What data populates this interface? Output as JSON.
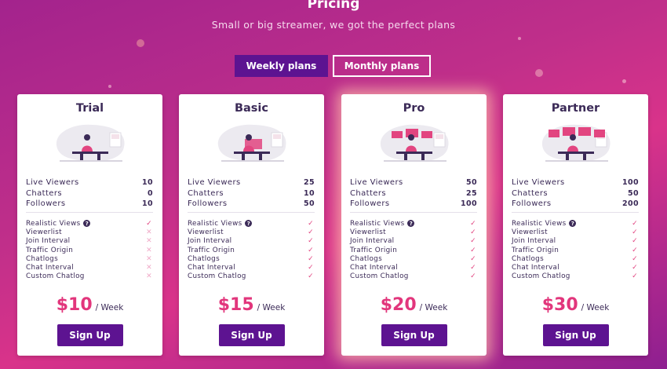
{
  "header": {
    "title": "Pricing",
    "subtitle": "Small or big streamer, we got the perfect plans"
  },
  "toggle": {
    "weekly_label": "Weekly plans",
    "monthly_label": "Monthly plans",
    "active": "weekly"
  },
  "colors": {
    "accent_purple": "#5d1391",
    "price_pink": "#e2367c",
    "check_pink": "#e24580"
  },
  "stat_labels": {
    "viewers": "Live Viewers",
    "chatters": "Chatters",
    "followers": "Followers"
  },
  "feature_labels": [
    "Realistic Views",
    "Viewerlist",
    "Join Interval",
    "Traffic Origin",
    "Chatlogs",
    "Chat Interval",
    "Custom Chatlog"
  ],
  "plans": [
    {
      "name": "Trial",
      "viewers": "10",
      "chatters": "0",
      "followers": "10",
      "features": [
        true,
        false,
        false,
        false,
        false,
        false,
        false
      ],
      "price": "$10",
      "period": "/ Week",
      "signup_label": "Sign Up",
      "featured": false
    },
    {
      "name": "Basic",
      "viewers": "25",
      "chatters": "10",
      "followers": "50",
      "features": [
        true,
        true,
        true,
        true,
        true,
        true,
        true
      ],
      "price": "$15",
      "period": "/ Week",
      "signup_label": "Sign Up",
      "featured": false
    },
    {
      "name": "Pro",
      "viewers": "50",
      "chatters": "25",
      "followers": "100",
      "features": [
        true,
        true,
        true,
        true,
        true,
        true,
        true
      ],
      "price": "$20",
      "period": "/ Week",
      "signup_label": "Sign Up",
      "featured": true
    },
    {
      "name": "Partner",
      "viewers": "100",
      "chatters": "50",
      "followers": "200",
      "features": [
        true,
        true,
        true,
        true,
        true,
        true,
        true
      ],
      "price": "$30",
      "period": "/ Week",
      "signup_label": "Sign Up",
      "featured": false
    }
  ],
  "icons": {
    "check": "check-icon",
    "cross": "cross-icon",
    "help": "question-circle-icon"
  }
}
